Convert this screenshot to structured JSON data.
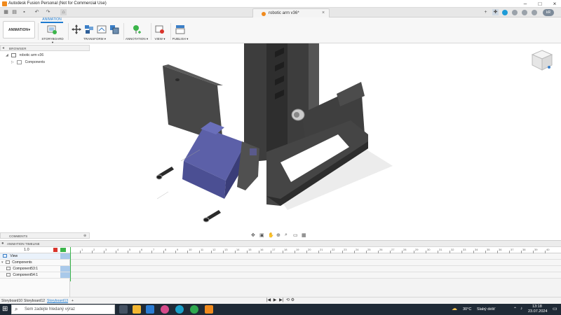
{
  "window": {
    "title": "Autodesk Fusion Personal (Not for Commercial Use)",
    "controls": {
      "minimize": "–",
      "maximize": "□",
      "close": "×"
    }
  },
  "tabbar": {
    "doc_tab": "robotic arm v36*",
    "doc_close": "×",
    "add_tab": "+",
    "undo": "↶",
    "redo": "↷",
    "user_initials": "kR"
  },
  "toolbar": {
    "workspace": "ANIMATION",
    "workspace_caret": "▾",
    "mode_tab": "ANIMATION",
    "groups": [
      {
        "label": "STORYBOARD ▾",
        "icon": "storyboard-icon"
      },
      {
        "label": "TRANSFORM ▾",
        "icon": "transform-icon"
      },
      {
        "label": "ANNOTATION ▾",
        "icon": "annotation-icon"
      },
      {
        "label": "VIEW ▾",
        "icon": "view-icon"
      },
      {
        "label": "PUBLISH ▾",
        "icon": "publish-icon"
      }
    ]
  },
  "browser": {
    "header": "BROWSER",
    "root": "robotic arm v36",
    "children": [
      "Components"
    ]
  },
  "comments": {
    "header": "COMMENTS"
  },
  "timeline": {
    "header": "ANIMATION TIMELINE",
    "time": "1.0",
    "rows": [
      {
        "label": "View",
        "kind": "view"
      },
      {
        "label": "Components",
        "kind": "group"
      },
      {
        "label": "Component53:1",
        "kind": "component"
      },
      {
        "label": "Component54:1",
        "kind": "component"
      }
    ],
    "ticks": [
      "1",
      "2",
      "3",
      "4",
      "5",
      "6",
      "7",
      "8",
      "9",
      "10",
      "11",
      "12",
      "13",
      "14",
      "15",
      "16",
      "17",
      "18",
      "19",
      "20",
      "21",
      "22",
      "23",
      "24",
      "25",
      "26",
      "27",
      "28",
      "29",
      "30",
      "31",
      "32",
      "33",
      "34",
      "35",
      "36",
      "37",
      "38",
      "39",
      "40"
    ]
  },
  "storyboards": {
    "tabs": [
      "Storyboard10",
      "Storyboard12",
      "Storyboard13"
    ],
    "active": "Storyboard13",
    "add": "+"
  },
  "playback": {
    "prev": "|◀",
    "play": "▶",
    "next": "▶|",
    "loop": "⟲",
    "settings": "⚙"
  },
  "taskbar": {
    "search_placeholder": "Sem zadejte hledaný výraz",
    "weather_temp": "30°C",
    "weather_text": "Slabý déšť",
    "time": "13:18",
    "date": "23.07.2024"
  },
  "colors": {
    "accent": "#1e7bd0",
    "servo": "#4b4f93",
    "model_dark": "#3a3a3a",
    "taskbar": "#1f2a36",
    "keyframe": "#a9c9ea"
  }
}
